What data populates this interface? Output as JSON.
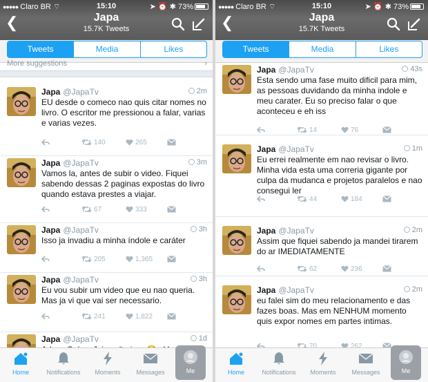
{
  "screens": [
    {
      "status": {
        "carrier": "Claro BR",
        "time": "15:10",
        "battery": "73%"
      },
      "header": {
        "title": "Japa",
        "subtitle": "15.7K Tweets"
      },
      "tabs": [
        {
          "label": "Tweets",
          "active": true
        },
        {
          "label": "Media",
          "active": false
        },
        {
          "label": "Likes",
          "active": false
        }
      ],
      "more_suggestions": "More suggestions",
      "tweets": [
        {
          "name": "Japa",
          "handle": "@JapaTv",
          "time": "2m",
          "text": "EU desde o comeco nao quis citar nomes no livro. O escritor me pressionou a falar, varias e varias vezes.",
          "retweets": "140",
          "likes": "265"
        },
        {
          "name": "Japa",
          "handle": "@JapaTv",
          "time": "3m",
          "text": "Vamos la, antes de subir o video. Fiquei sabendo dessas 2 paginas expostas do livro quando estava prestes a viajar.",
          "retweets": "67",
          "likes": "333"
        },
        {
          "name": "Japa",
          "handle": "@JapaTv",
          "time": "3h",
          "text": "Isso ja invadiu a minha índole e caráter",
          "retweets": "205",
          "likes": "1,365"
        },
        {
          "name": "Japa",
          "handle": "@JapaTv",
          "time": "3h",
          "text": "Eu vou subir um video que eu nao queria. Mas ja vi que vai ser necessario.",
          "retweets": "241",
          "likes": "1,822"
        },
        {
          "name": "Japa",
          "handle": "@JapaTv",
          "time": "1d",
          "text": "Adeus Suíca. Jaja volto juro 😂 . Vamo",
          "retweets": "",
          "likes": ""
        }
      ],
      "tabbar": [
        "Home",
        "Notifications",
        "Moments",
        "Messages",
        "Me"
      ]
    },
    {
      "status": {
        "carrier": "Claro BR",
        "time": "15:10",
        "battery": "73%"
      },
      "header": {
        "title": "Japa",
        "subtitle": "15.7K Tweets"
      },
      "tabs": [
        {
          "label": "Tweets",
          "active": true
        },
        {
          "label": "Media",
          "active": false
        },
        {
          "label": "Likes",
          "active": false
        }
      ],
      "tweets": [
        {
          "name": "Japa",
          "handle": "@JapaTv",
          "time": "43s",
          "text": "Esta sendo uma fase muito dificil para mim, as pessoas duvidando da minha indole e meu carater. Eu so preciso falar o que aconteceu e eh iss",
          "retweets": "14",
          "likes": "76"
        },
        {
          "name": "Japa",
          "handle": "@JapaTv",
          "time": "1m",
          "text": "Eu errei realmente em nao revisar o livro. Minha vida esta uma correria gigante por culpa da mudanca e projetos paralelos e nao consegui ler",
          "retweets": "44",
          "likes": "184"
        },
        {
          "name": "Japa",
          "handle": "@JapaTv",
          "time": "2m",
          "text": "Assim que fiquei sabendo ja mandei tirarem do ar IMEDIATAMENTE",
          "retweets": "62",
          "likes": "236"
        },
        {
          "name": "Japa",
          "handle": "@JapaTv",
          "time": "2m",
          "text": "eu falei sim do meu relacionamento e das fazes boas. Mas em NENHUM momento quis expor nomes em partes intimas.",
          "retweets": "70",
          "likes": "262"
        }
      ],
      "tabbar": [
        "Home",
        "Notifications",
        "Moments",
        "Messages",
        "Me"
      ]
    }
  ],
  "colors": {
    "accent": "#1da1f2",
    "muted": "#8899a6",
    "icon": "#aab8c2"
  }
}
